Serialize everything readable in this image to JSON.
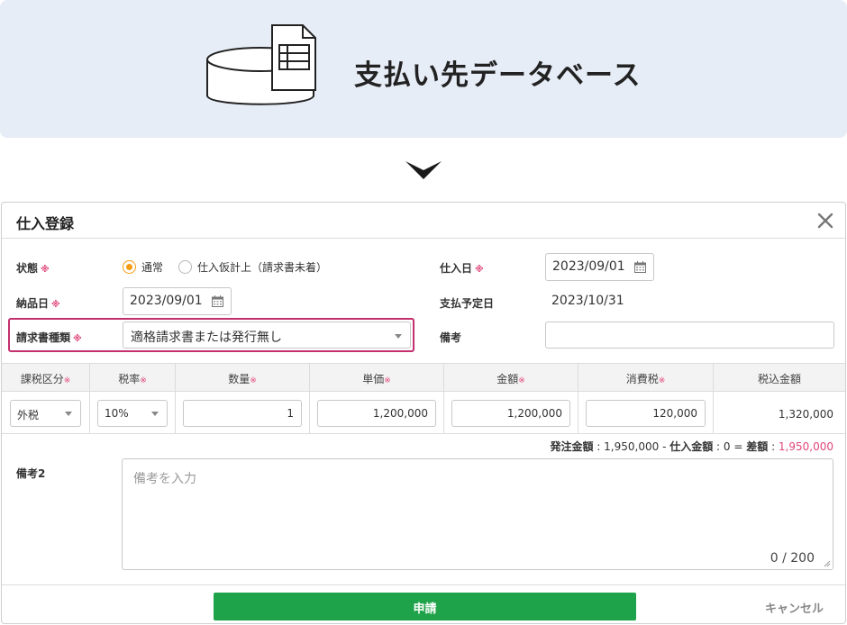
{
  "banner": {
    "title": "支払い先データベース",
    "icon": "database-spreadsheet-icon"
  },
  "arrow": {
    "icon": "chevron-down-icon"
  },
  "dialog": {
    "title": "仕入登録",
    "close_icon": "close-icon",
    "required_mark": "※",
    "status": {
      "label": "状態",
      "options": [
        "通常",
        "仕入仮計上（請求書未着）"
      ],
      "selected": "通常"
    },
    "purchase_date": {
      "label": "仕入日",
      "value": "2023/09/01"
    },
    "delivery_date": {
      "label": "納品日",
      "value": "2023/09/01"
    },
    "payment_due": {
      "label": "支払予定日",
      "value": "2023/10/31"
    },
    "invoice_type": {
      "label": "請求書種類",
      "value": "適格請求書または発行無し"
    },
    "remarks": {
      "label": "備考",
      "value": ""
    },
    "table": {
      "headers": [
        "課税区分",
        "税率",
        "数量",
        "単価",
        "金額",
        "消費税",
        "税込金額"
      ],
      "row": {
        "tax_category": "外税",
        "tax_rate": "10%",
        "quantity": "1",
        "unit_price": "1,200,000",
        "amount": "1,200,000",
        "tax": "120,000",
        "total": "1,320,000"
      }
    },
    "summary": {
      "order_label": "発注金額",
      "order_value": "1,950,000",
      "purchase_label": "仕入金額",
      "purchase_value": "0",
      "diff_label": "差額",
      "diff_value": "1,950,000"
    },
    "remarks2": {
      "label": "備考2",
      "placeholder": "備考を入力",
      "counter": "0 / 200"
    },
    "submit_label": "申請",
    "cancel_label": "キャンセル"
  },
  "colors": {
    "accent": "#f39c12",
    "required": "#e0457b",
    "highlight": "#c3306e",
    "submit": "#1fa34a",
    "banner_bg": "#e7edf7"
  }
}
